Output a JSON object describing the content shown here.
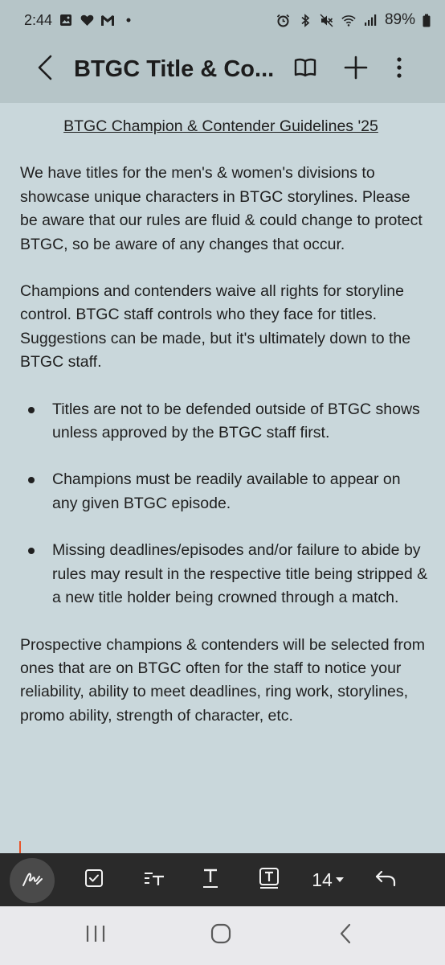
{
  "status_bar": {
    "time": "2:44",
    "battery": "89%",
    "icons_left": [
      "image-icon",
      "heart-icon",
      "gmail-icon",
      "dot-icon"
    ],
    "icons_right": [
      "alarm-icon",
      "bluetooth-icon",
      "mute-icon",
      "wifi-icon",
      "signal-icon",
      "battery-icon"
    ]
  },
  "app_bar": {
    "title": "BTGC Title & Co..."
  },
  "document": {
    "title": "BTGC Champion & Contender Guidelines '25",
    "paragraphs": [
      "We have titles for the men's & women's divisions to showcase unique characters in BTGC storylines. Please be aware that our rules are fluid & could change to protect BTGC, so be aware of any changes that occur.",
      "Champions and contenders waive all rights for storyline control. BTGC staff controls who they face for titles. Suggestions can be made, but it's ultimately down to the BTGC staff."
    ],
    "bullets": [
      "Titles are not to be defended outside of BTGC shows unless approved by the BTGC staff first.",
      "Champions must be readily available to appear on any given BTGC episode.",
      "Missing deadlines/episodes and/or failure to abide by rules may result in the respective title being stripped & a new title holder being crowned through a match."
    ],
    "closing": "Prospective champions & contenders will be selected from ones that are on BTGC often for the staff to notice your reliability, ability to meet deadlines, ring work, storylines, promo ability, strength of character, etc."
  },
  "toolbar": {
    "font_size": "14"
  },
  "colors": {
    "page_background": "#c9d7db",
    "header_background": "#b6c5c8",
    "toolbar_background": "#2a2a2a",
    "cursor": "#e8542a",
    "nav_background": "#e9e9ec"
  }
}
